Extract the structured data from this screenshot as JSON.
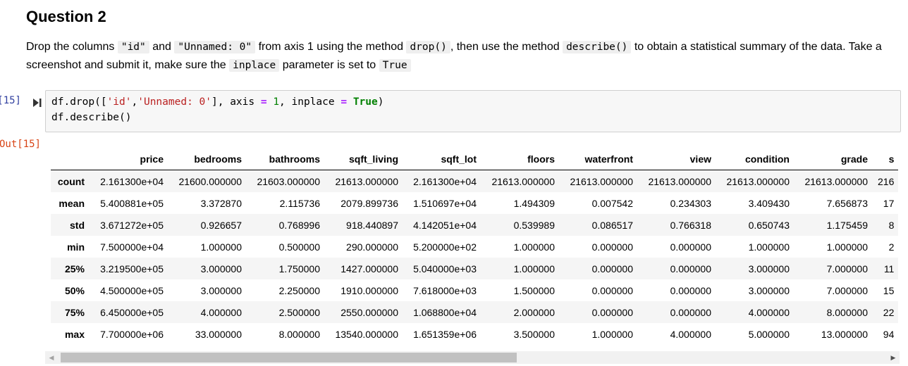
{
  "heading": "Question 2",
  "instructions": {
    "t1": "Drop the columns ",
    "c1": "\"id\"",
    "t2": " and ",
    "c2": "\"Unnamed: 0\"",
    "t3": " from axis 1 using the method ",
    "c3": "drop()",
    "t4": ", then use the method ",
    "c4": "describe()",
    "t5": " to obtain a statistical summary of the data. Take a screenshot and submit it, make sure the ",
    "c5": "inplace",
    "t6": " parameter is set to ",
    "c6": "True"
  },
  "input_prompt": "In [15]:",
  "output_prompt": "Out[15]:",
  "code": {
    "l1_a": "df.drop([",
    "l1_s1": "'id'",
    "l1_b": ",",
    "l1_s2": "'Unnamed: 0'",
    "l1_c": "], axis ",
    "l1_eq1": "=",
    "l1_sp1": " ",
    "l1_n": "1",
    "l1_d": ", inplace ",
    "l1_eq2": "=",
    "l1_sp2": " ",
    "l1_kw": "True",
    "l1_e": ")",
    "l2": "df.describe()"
  },
  "table": {
    "columns": [
      "price",
      "bedrooms",
      "bathrooms",
      "sqft_living",
      "sqft_lot",
      "floors",
      "waterfront",
      "view",
      "condition",
      "grade",
      "s"
    ],
    "rows": [
      {
        "index": "count",
        "values": [
          "2.161300e+04",
          "21600.000000",
          "21603.000000",
          "21613.000000",
          "2.161300e+04",
          "21613.000000",
          "21613.000000",
          "21613.000000",
          "21613.000000",
          "21613.000000",
          "216"
        ]
      },
      {
        "index": "mean",
        "values": [
          "5.400881e+05",
          "3.372870",
          "2.115736",
          "2079.899736",
          "1.510697e+04",
          "1.494309",
          "0.007542",
          "0.234303",
          "3.409430",
          "7.656873",
          "17"
        ]
      },
      {
        "index": "std",
        "values": [
          "3.671272e+05",
          "0.926657",
          "0.768996",
          "918.440897",
          "4.142051e+04",
          "0.539989",
          "0.086517",
          "0.766318",
          "0.650743",
          "1.175459",
          "8"
        ]
      },
      {
        "index": "min",
        "values": [
          "7.500000e+04",
          "1.000000",
          "0.500000",
          "290.000000",
          "5.200000e+02",
          "1.000000",
          "0.000000",
          "0.000000",
          "1.000000",
          "1.000000",
          "2"
        ]
      },
      {
        "index": "25%",
        "values": [
          "3.219500e+05",
          "3.000000",
          "1.750000",
          "1427.000000",
          "5.040000e+03",
          "1.000000",
          "0.000000",
          "0.000000",
          "3.000000",
          "7.000000",
          "11"
        ]
      },
      {
        "index": "50%",
        "values": [
          "4.500000e+05",
          "3.000000",
          "2.250000",
          "1910.000000",
          "7.618000e+03",
          "1.500000",
          "0.000000",
          "0.000000",
          "3.000000",
          "7.000000",
          "15"
        ]
      },
      {
        "index": "75%",
        "values": [
          "6.450000e+05",
          "4.000000",
          "2.500000",
          "2550.000000",
          "1.068800e+04",
          "2.000000",
          "0.000000",
          "0.000000",
          "4.000000",
          "8.000000",
          "22"
        ]
      },
      {
        "index": "max",
        "values": [
          "7.700000e+06",
          "33.000000",
          "8.000000",
          "13540.000000",
          "1.651359e+06",
          "3.500000",
          "1.000000",
          "4.000000",
          "5.000000",
          "13.000000",
          "94"
        ]
      }
    ]
  },
  "scrollbar": {
    "left_arrow": "◀",
    "right_arrow": "▶",
    "position_fraction": 0.0,
    "visible_fraction": 0.55
  },
  "icons": {
    "run": "run-cell-icon"
  }
}
